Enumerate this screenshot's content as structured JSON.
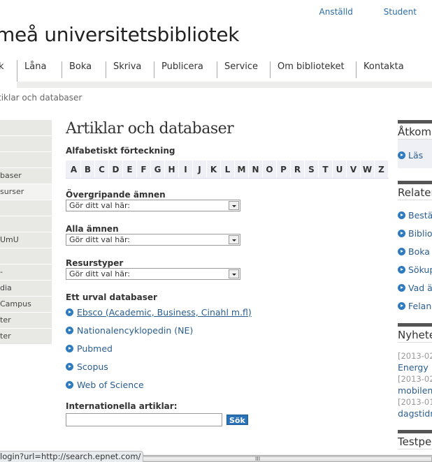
{
  "top_links": [
    "Anställd",
    "Student"
  ],
  "site_title": "meå universitetsbibliotek",
  "main_nav": [
    "k",
    "Låna",
    "Boka",
    "Skriva",
    "Publicera",
    "Service",
    "Om biblioteket",
    "Kontakta"
  ],
  "breadcrumb": "tiklar och databaser",
  "left_nav": [
    "",
    "",
    "",
    "baser",
    "surser",
    "",
    "",
    " UmU",
    "",
    "-",
    "dia",
    "Campus",
    "ter",
    "ter"
  ],
  "left_nav_active_index": 4,
  "content": {
    "title": "Artiklar och databaser",
    "alpha_heading": "Alfabetiskt förteckning",
    "letters": [
      "A",
      "B",
      "C",
      "D",
      "E",
      "F",
      "G",
      "H",
      "I",
      "J",
      "K",
      "L",
      "M",
      "N",
      "O",
      "P",
      "R",
      "S",
      "T",
      "U",
      "V",
      "W",
      "Z"
    ],
    "filters": [
      {
        "label": "Övergripande ämnen",
        "value": "Gör ditt val här:"
      },
      {
        "label": "Alla ämnen",
        "value": "Gör ditt val här:"
      },
      {
        "label": "Resurstyper",
        "value": "Gör ditt val här:"
      }
    ],
    "db_heading": "Ett urval databaser",
    "databases": [
      "Ebsco (Academic, Business, Cinahl m.fl)",
      "Nationalencyklopedin (NE)",
      "Pubmed",
      "Scopus",
      "Web of Science"
    ],
    "intl_label": "Internationella artiklar:",
    "intl_input_value": "",
    "search_button": "Sök"
  },
  "right": {
    "access_heading": "Åtkom",
    "access_link": "Läs",
    "related_heading": "Relater",
    "related_links": [
      "Bestä",
      "Biblio",
      "Boka",
      "Sökup",
      "Vad ä",
      "Felan"
    ],
    "news_heading": "Nyhete",
    "news": [
      {
        "date": "[2013-02",
        "title": "Energy"
      },
      {
        "date": "[2013-02",
        "title": "mobilen"
      },
      {
        "date": "[2013-01",
        "title": "dagstidn"
      }
    ],
    "test_heading": "Testpe"
  },
  "status_url": "login?url=http://search.epnet.com/",
  "scroll_grip": "III"
}
